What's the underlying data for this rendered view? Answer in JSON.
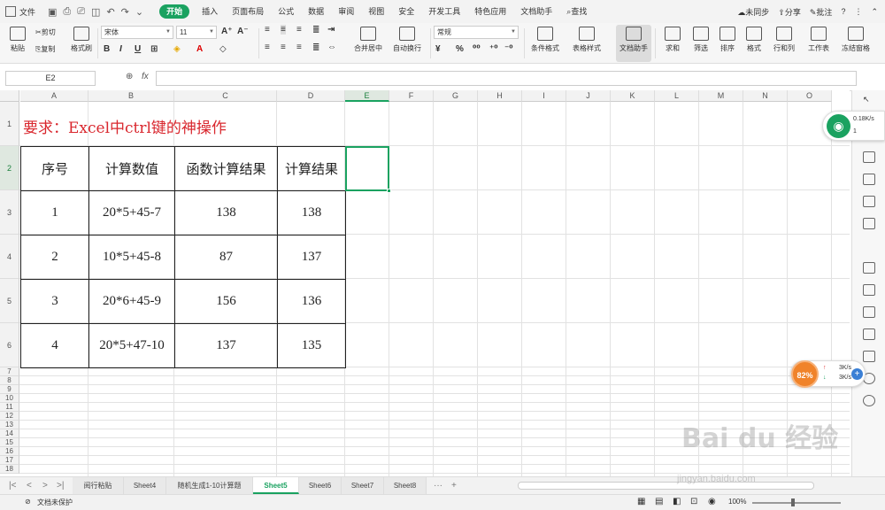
{
  "menubar": {
    "file_label": "文件",
    "tabs": [
      "开始",
      "插入",
      "页面布局",
      "公式",
      "数据",
      "审阅",
      "视图",
      "安全",
      "开发工具",
      "特色应用",
      "文档助手"
    ],
    "search_label": "查找",
    "right": {
      "sync": "未同步",
      "share": "分享",
      "comment": "批注",
      "help": "?"
    }
  },
  "ribbon": {
    "paste": "粘贴",
    "cut": "剪切",
    "copy": "复制",
    "format_painter": "格式刷",
    "font_name": "宋体",
    "font_size": "11",
    "merge_center": "合并居中",
    "wrap_text": "自动换行",
    "number_format": "常规",
    "percent": "%",
    "cond_format": "条件格式",
    "table_style": "表格样式",
    "doc_assistant": "文档助手",
    "sum": "求和",
    "filter": "筛选",
    "sort": "排序",
    "format": "格式",
    "row_col": "行和列",
    "worksheet": "工作表",
    "freeze": "冻结窗格"
  },
  "formula_bar": {
    "name_box": "E2",
    "fx": "fx",
    "formula": ""
  },
  "grid": {
    "columns": [
      "A",
      "B",
      "C",
      "D",
      "E",
      "F",
      "G",
      "H",
      "I",
      "J",
      "K",
      "L",
      "M",
      "N",
      "O"
    ],
    "rows": [
      "1",
      "2",
      "3",
      "4",
      "5",
      "6",
      "7",
      "8",
      "9",
      "10",
      "11",
      "12",
      "13",
      "14",
      "15",
      "16",
      "17",
      "18"
    ],
    "title": "要求：Excel中ctrl键的神操作",
    "table_headers": [
      "序号",
      "计算数值",
      "函数计算结果",
      "计算结果"
    ],
    "table_rows": [
      [
        "1",
        "20*5+45-7",
        "138",
        "138"
      ],
      [
        "2",
        "10*5+45-8",
        "87",
        "137"
      ],
      [
        "3",
        "20*6+45-9",
        "156",
        "136"
      ],
      [
        "4",
        "20*5+47-10",
        "137",
        "135"
      ]
    ],
    "selected_cell": "E2"
  },
  "widgets": {
    "network_speed": "0.18K/s",
    "network_count": "1",
    "accel_percent": "82%",
    "upload": "3K/s",
    "download": "3K/s"
  },
  "sheets": [
    "阅行粘贴",
    "Sheet4",
    "随机生成1-10计算题",
    "Sheet5",
    "Sheet6",
    "Sheet7",
    "Sheet8"
  ],
  "active_sheet": "Sheet5",
  "status": {
    "protect": "文档未保护",
    "zoom": "100%"
  },
  "watermark": {
    "brand": "Bai du 经验",
    "url": "jingyan.baidu.com"
  },
  "colors": {
    "accent": "#1aa260",
    "title_red": "#d9272e"
  }
}
